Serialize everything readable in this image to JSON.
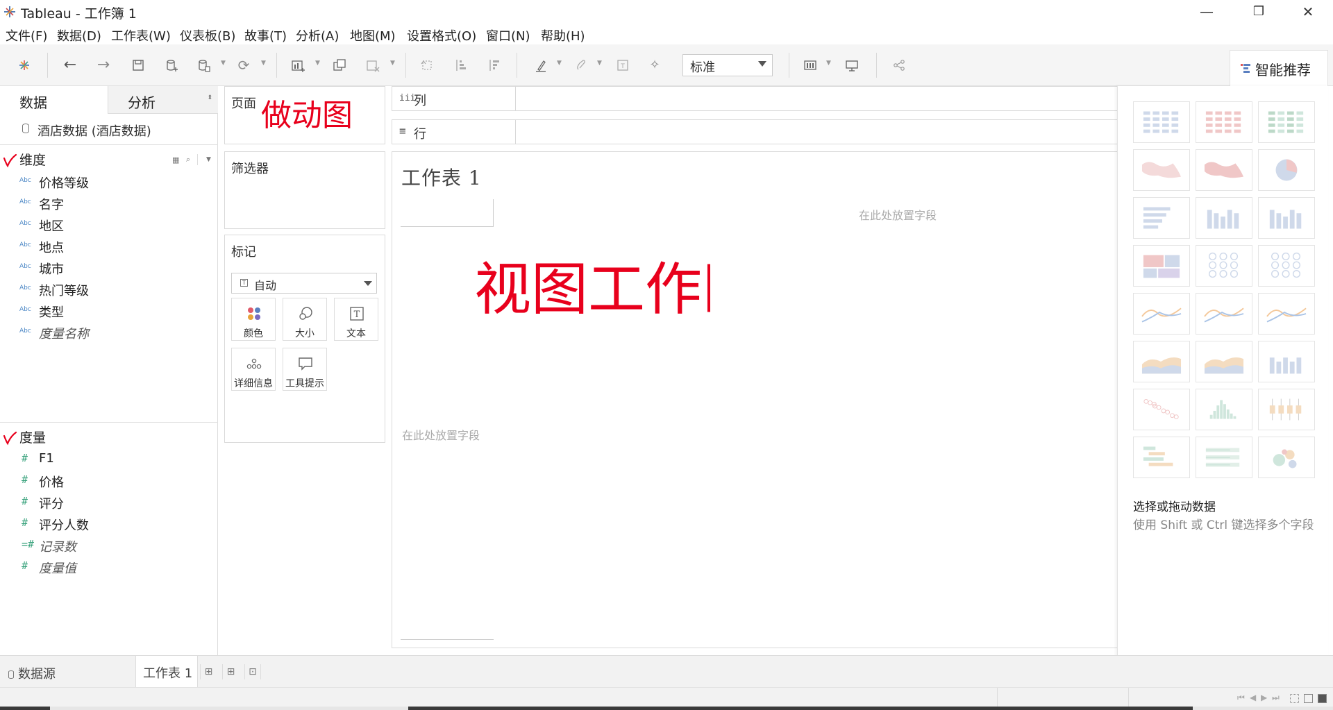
{
  "window": {
    "title": "Tableau - 工作簿 1",
    "minimize": "—",
    "restore": "❐",
    "close": "✕"
  },
  "menu": [
    "文件(F)",
    "数据(D)",
    "工作表(W)",
    "仪表板(B)",
    "故事(T)",
    "分析(A)",
    "地图(M)",
    "设置格式(O)",
    "窗口(N)",
    "帮助(H)"
  ],
  "toolbar": {
    "fit_select_value": "标准",
    "smart_tab_label": "智能推荐"
  },
  "datapane": {
    "tab_data": "数据",
    "tab_analysis": "分析",
    "datasource": "酒店数据 (酒店数据)",
    "dimensions_title": "维度",
    "dimensions": [
      {
        "type": "Abc",
        "name": "价格等级",
        "italic": false
      },
      {
        "type": "Abc",
        "name": "名字",
        "italic": false
      },
      {
        "type": "Abc",
        "name": "地区",
        "italic": false
      },
      {
        "type": "Abc",
        "name": "地点",
        "italic": false
      },
      {
        "type": "Abc",
        "name": "城市",
        "italic": false
      },
      {
        "type": "Abc",
        "name": "热门等级",
        "italic": false
      },
      {
        "type": "Abc",
        "name": "类型",
        "italic": false
      },
      {
        "type": "Abc",
        "name": "度量名称",
        "italic": true
      }
    ],
    "measures_title": "度量",
    "measures": [
      {
        "type": "#",
        "name": "F1",
        "italic": false
      },
      {
        "type": "#",
        "name": "价格",
        "italic": false
      },
      {
        "type": "#",
        "name": "评分",
        "italic": false
      },
      {
        "type": "#",
        "name": "评分人数",
        "italic": false
      },
      {
        "type": "=#",
        "name": "记录数",
        "italic": true
      },
      {
        "type": "#",
        "name": "度量值",
        "italic": true
      }
    ]
  },
  "shelves": {
    "pages_title": "页面",
    "pages_annotation": "做动图",
    "filters_title": "筛选器",
    "marks_title": "标记",
    "marks_type": "自动",
    "marks_buttons": [
      "颜色",
      "大小",
      "文本",
      "详细信息",
      "工具提示"
    ],
    "columns_label": "列",
    "rows_label": "行",
    "columns_icon": "iii",
    "rows_icon": "≡"
  },
  "view": {
    "sheet_title": "工作表 1",
    "drop_field_top": "在此处放置字段",
    "drop_field_left": "在此处放置字段",
    "annotation": "视图工作区"
  },
  "smart": {
    "hint_title": "选择或拖动数据",
    "hint_body": "使用 Shift 或 Ctrl 键选择多个字段"
  },
  "tabs": {
    "datasource": "数据源",
    "sheet": "工作表 1"
  },
  "colors": {
    "annotation_red": "#e8001c",
    "measure_green": "#3aa37d",
    "dimension_blue": "#4a86c5"
  }
}
